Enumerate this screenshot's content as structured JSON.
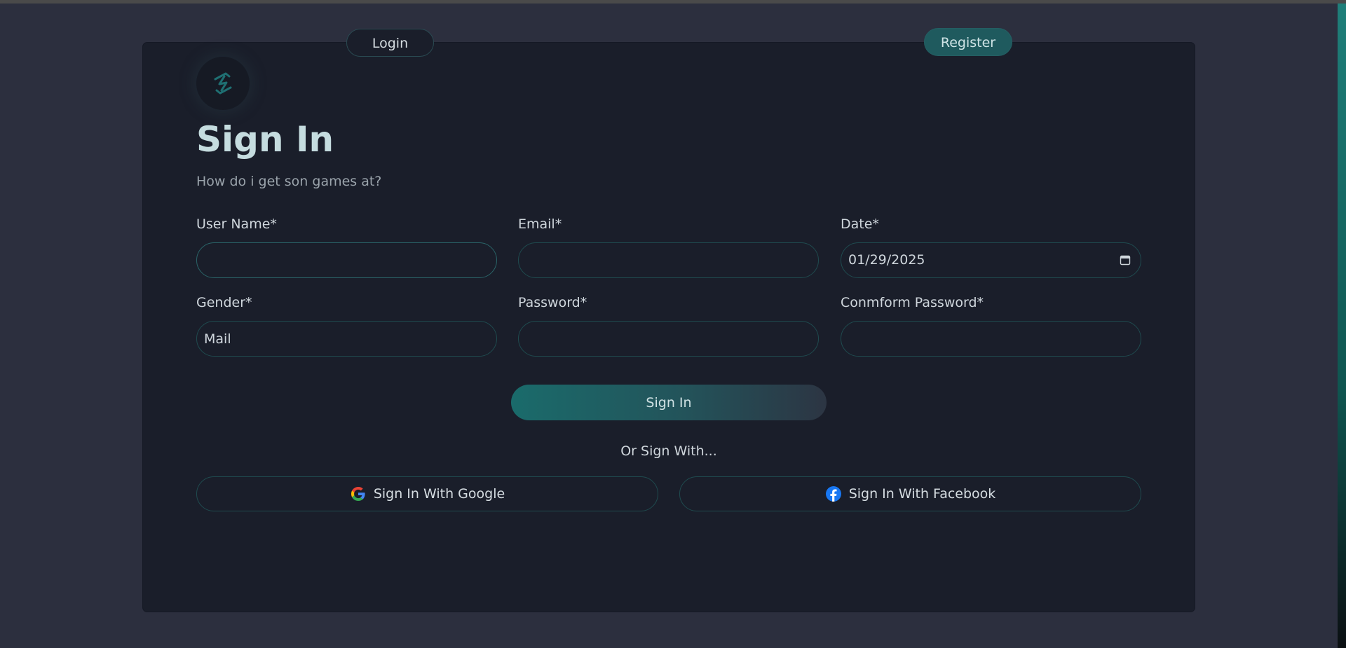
{
  "tabs": {
    "login": "Login",
    "register": "Register"
  },
  "header": {
    "title": "Sign In",
    "subtitle": "How do i get son games at?"
  },
  "form": {
    "username": {
      "label": "User Name*",
      "value": ""
    },
    "email": {
      "label": "Email*",
      "value": ""
    },
    "date": {
      "label": "Date*",
      "value": "01/29/2025"
    },
    "gender": {
      "label": "Gender*",
      "value": "Mail"
    },
    "password": {
      "label": "Password*",
      "value": ""
    },
    "confirm_password": {
      "label": "Conmform Password*",
      "value": ""
    }
  },
  "actions": {
    "submit": "Sign In",
    "or_text": "Or Sign With...",
    "google": "Sign In With Google",
    "facebook": "Sign In With Facebook"
  },
  "colors": {
    "background": "#2c2f3e",
    "card": "#1a1e2a",
    "accent": "#1f6b6b",
    "title": "#c5dcdf"
  },
  "icons": {
    "logo": "lightning-logo-icon",
    "calendar": "calendar-icon",
    "google": "google-logo-icon",
    "facebook": "facebook-logo-icon"
  }
}
